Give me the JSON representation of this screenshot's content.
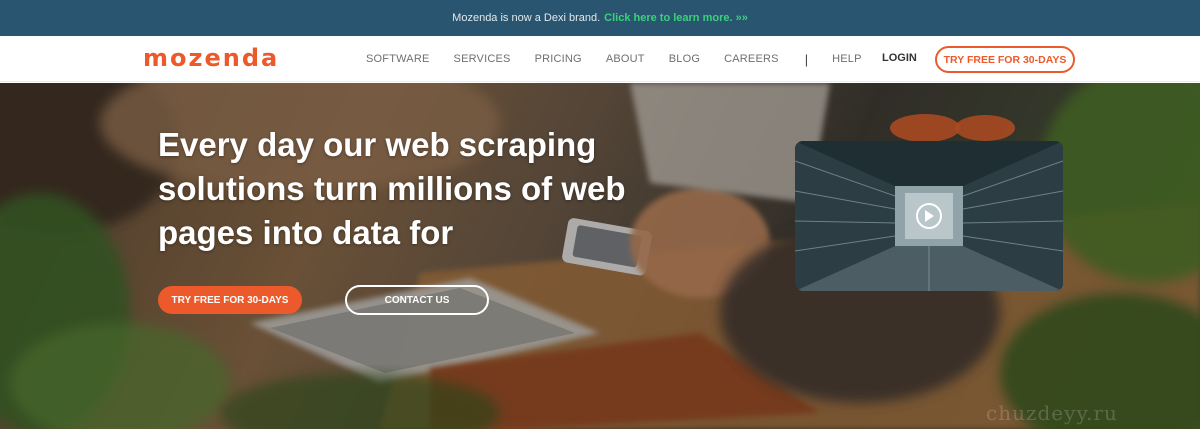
{
  "announcement": {
    "text": "Mozenda is now a Dexi brand.",
    "link": "Click here to learn more. »»",
    "background": "#2a5570",
    "link_color": "#3ad17a"
  },
  "nav": {
    "logo": "mozenda",
    "menu": [
      "SOFTWARE",
      "SERVICES",
      "PRICING",
      "ABOUT",
      "BLOG",
      "CAREERS"
    ],
    "separator": "|",
    "help": "HELP",
    "login": "LOGIN",
    "cta": "TRY FREE FOR 30-DAYS"
  },
  "hero": {
    "title": "Every day our web scraping solutions turn millions of web pages into data for",
    "primary_button": "TRY FREE FOR 30-DAYS",
    "secondary_button": "CONTACT US",
    "video_icon": "play-icon"
  },
  "watermark": "chuzdeyy.ru",
  "colors": {
    "brand": "#ec5a2b",
    "text_white": "#ffffff"
  }
}
